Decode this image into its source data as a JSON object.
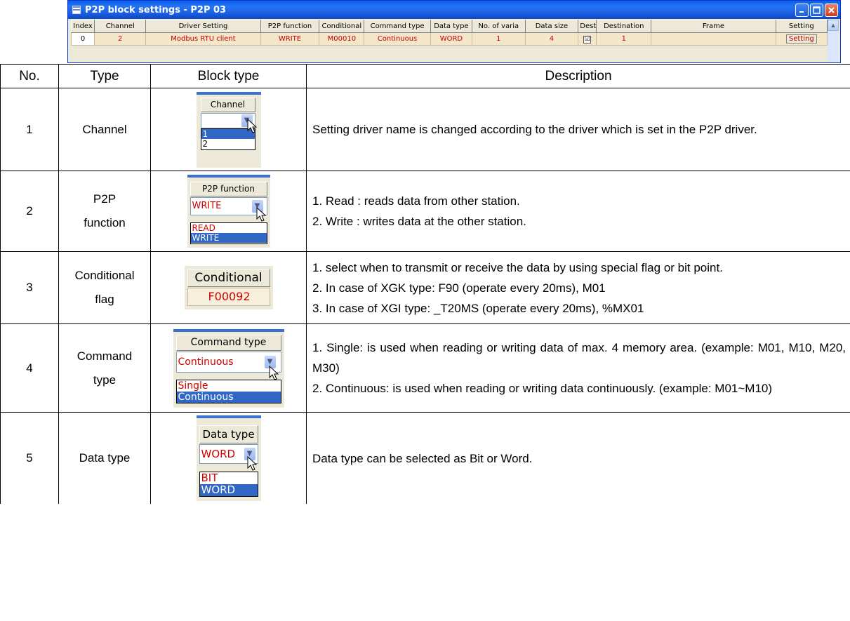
{
  "window": {
    "title": "P2P block settings - P2P 03",
    "columns": [
      "Index",
      "Channel",
      "Driver Setting",
      "P2P function",
      "Conditional",
      "Command type",
      "Data type",
      "No. of varia",
      "Data size",
      "Desti",
      "Destination",
      "Frame",
      "Setting"
    ],
    "row": {
      "index": "0",
      "channel": "2",
      "driver_setting": "Modbus RTU client",
      "p2p_function": "WRITE",
      "conditional": "M00010",
      "command_type": "Continuous",
      "data_type": "WORD",
      "no_of_variables": "1",
      "data_size": "4",
      "desti_checked": "☑",
      "destination": "1",
      "frame": "",
      "setting": "Setting"
    }
  },
  "table": {
    "headers": {
      "no": "No.",
      "type": "Type",
      "block_type": "Block type",
      "description": "Description"
    },
    "rows": [
      {
        "no": "1",
        "type_lines": [
          "Channel"
        ],
        "desc_lines": [
          "Setting driver name is changed according to the driver which is set in the P2P driver."
        ],
        "widget": {
          "header": "Channel",
          "combo": "",
          "options": [
            "1",
            "2"
          ]
        }
      },
      {
        "no": "2",
        "type_lines": [
          "P2P",
          "function"
        ],
        "desc_lines": [
          "1. Read : reads data from other station.",
          "2. Write : writes data at the other station."
        ],
        "widget": {
          "header": "P2P function",
          "combo": "WRITE",
          "options": [
            "READ",
            "WRITE"
          ]
        }
      },
      {
        "no": "3",
        "type_lines": [
          "Conditional",
          "flag"
        ],
        "desc_lines": [
          "1. select when to transmit or receive the data by using special flag or bit point.",
          "2. In case of XGK type: F90 (operate every 20ms), M01",
          "3. In case of XGI type: _T20MS (operate every 20ms), %MX01"
        ],
        "widget": {
          "header": "Conditional",
          "value": "F00092"
        }
      },
      {
        "no": "4",
        "type_lines": [
          "Command",
          "type"
        ],
        "desc_lines": [
          "1. Single: is used when reading or writing data of max. 4 memory area. (example: M01, M10, M20, M30)",
          "2. Continuous: is used when reading or writing data continuously. (example: M01~M10)"
        ],
        "widget": {
          "header": "Command type",
          "combo": "Continuous",
          "options": [
            "Single",
            "Continuous"
          ]
        }
      },
      {
        "no": "5",
        "type_lines": [
          "Data type"
        ],
        "desc_lines": [
          "Data type can be selected as Bit or Word."
        ],
        "widget": {
          "header": "Data type",
          "combo": "WORD",
          "options": [
            "BIT",
            "WORD"
          ]
        }
      }
    ]
  }
}
